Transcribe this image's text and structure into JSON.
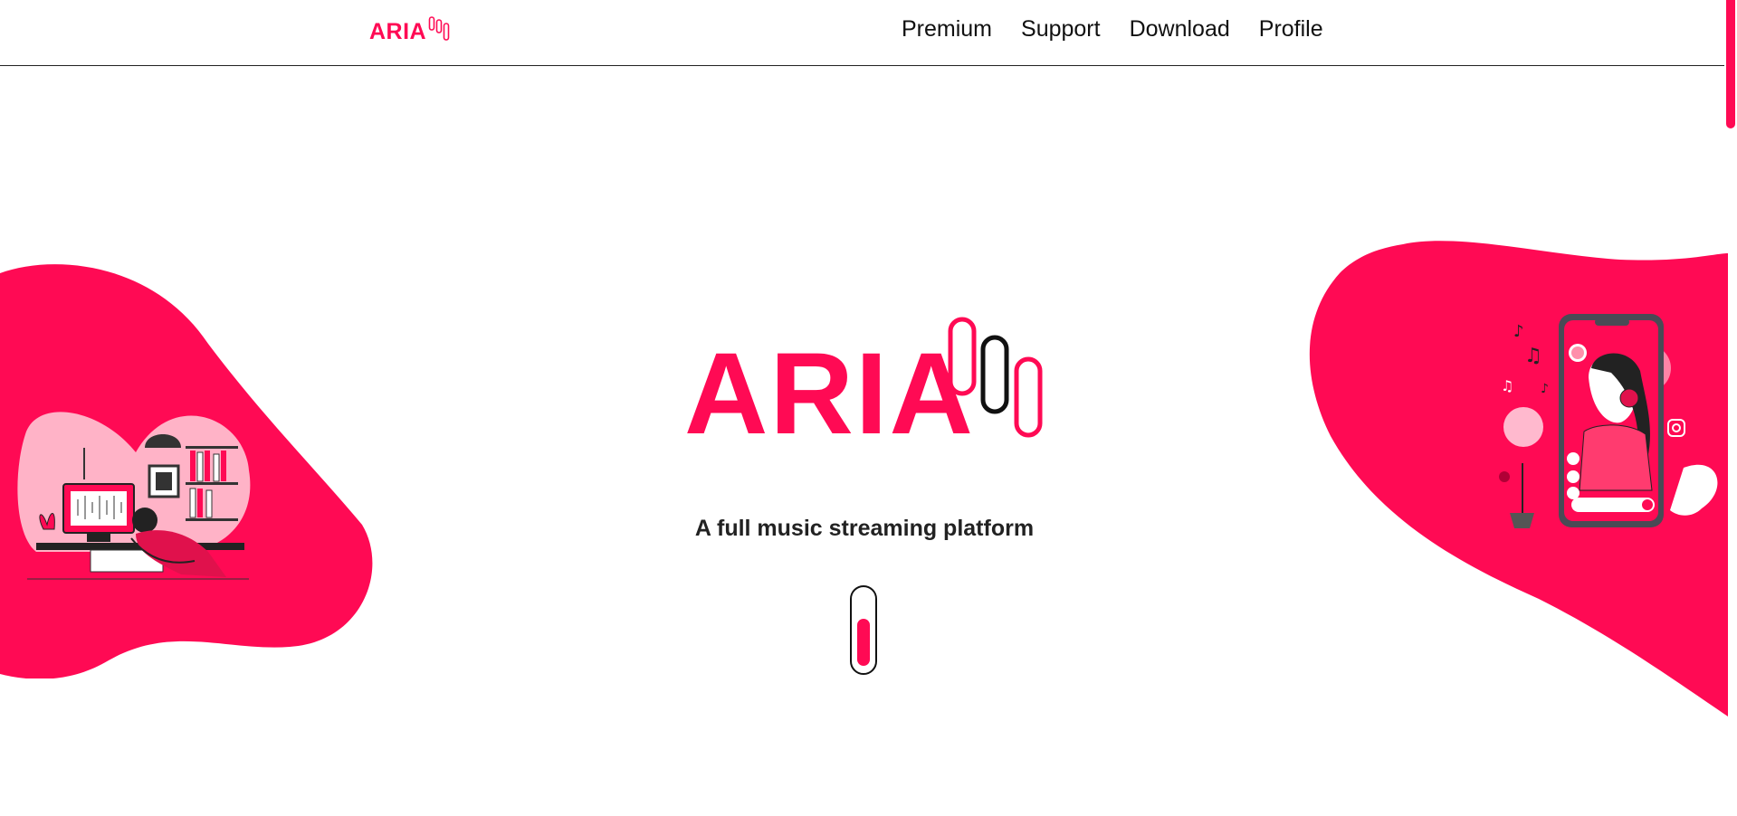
{
  "brand": {
    "name": "ARIA",
    "accent_color": "#ff0a54",
    "dark_color": "#111111"
  },
  "nav": {
    "links": [
      {
        "label": "Premium"
      },
      {
        "label": "Support"
      },
      {
        "label": "Download"
      },
      {
        "label": "Profile"
      }
    ]
  },
  "hero": {
    "logo_text": "ARIA",
    "tagline": "A full music streaming platform",
    "left_illustration": "person-resting-with-music-monitor-illustration",
    "right_illustration": "person-listening-on-phone-illustration",
    "scroll_icon": "mouse-scroll-icon"
  }
}
